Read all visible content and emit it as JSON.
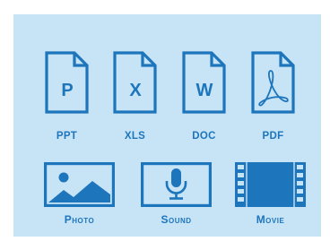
{
  "colors": {
    "icon": "#1d75bc",
    "background": "#c7e4f7"
  },
  "documents": [
    {
      "label": "PPT",
      "glyph": "P",
      "icon": "ppt-file-icon"
    },
    {
      "label": "XLS",
      "glyph": "X",
      "icon": "xls-file-icon"
    },
    {
      "label": "DOC",
      "glyph": "W",
      "icon": "doc-file-icon"
    },
    {
      "label": "PDF",
      "glyph": "",
      "icon": "pdf-file-icon"
    }
  ],
  "media": [
    {
      "label": "Photo",
      "icon": "photo-icon"
    },
    {
      "label": "Sound",
      "icon": "microphone-icon"
    },
    {
      "label": "Movie",
      "icon": "film-strip-icon"
    }
  ]
}
